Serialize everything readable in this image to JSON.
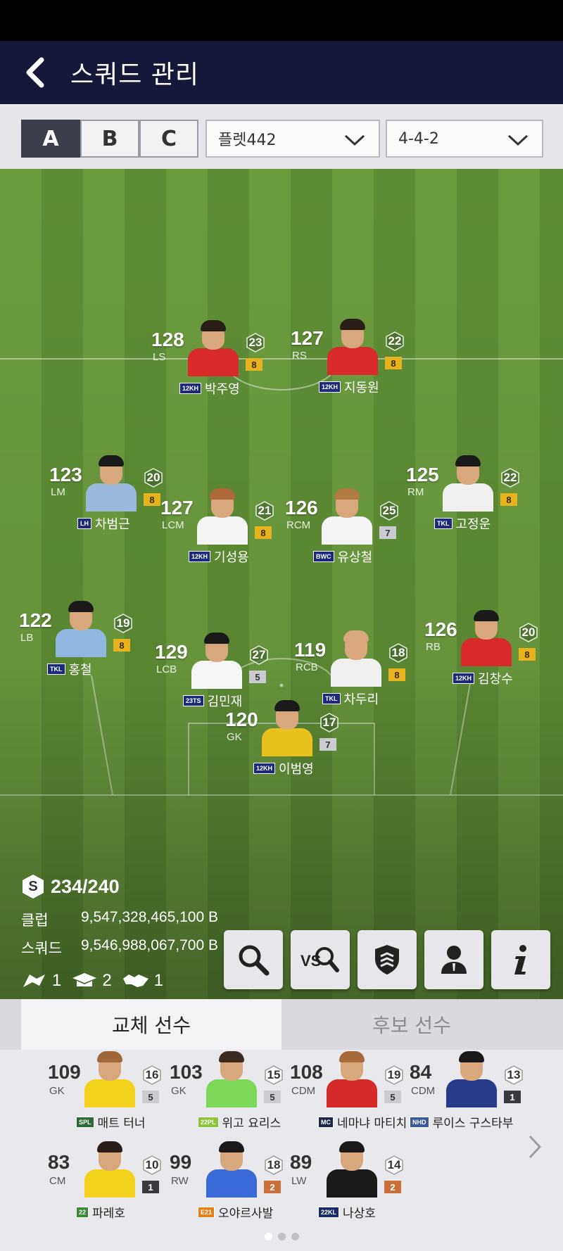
{
  "header": {
    "title": "스쿼드 관리"
  },
  "squad_tabs": [
    "A",
    "B",
    "C"
  ],
  "formation_select": "플렛442",
  "formation_value": "4-4-2",
  "colors": {
    "header_bg": "#16183a",
    "pitch_dark": "#5f8d35",
    "pitch_light": "#6c9b3e",
    "grade_gold": "#e6b31e"
  },
  "players": [
    {
      "ovr": "128",
      "pos": "LS",
      "level": "23",
      "grade": "8",
      "season": "12KH",
      "name": "박주영",
      "kit": "#d92a2a",
      "hair": "#2a1f18",
      "grade_color": "gold"
    },
    {
      "ovr": "127",
      "pos": "RS",
      "level": "22",
      "grade": "8",
      "season": "12KH",
      "name": "지동원",
      "kit": "#d92a2a",
      "hair": "#2a1f18",
      "grade_color": "gold"
    },
    {
      "ovr": "123",
      "pos": "LM",
      "level": "20",
      "grade": "8",
      "season": "LH",
      "name": "차범근",
      "kit": "#9bb8dc",
      "hair": "#1a1a1a",
      "grade_color": "gold"
    },
    {
      "ovr": "125",
      "pos": "RM",
      "level": "22",
      "grade": "8",
      "season": "TKL",
      "name": "고정운",
      "kit": "#f0f0f0",
      "hair": "#1a1a1a",
      "grade_color": "gold"
    },
    {
      "ovr": "127",
      "pos": "LCM",
      "level": "21",
      "grade": "8",
      "season": "12KH",
      "name": "기성용",
      "kit": "#f4f4f4",
      "hair": "#b06a3a",
      "grade_color": "gold"
    },
    {
      "ovr": "126",
      "pos": "RCM",
      "level": "25",
      "grade": "7",
      "season": "BWC",
      "name": "유상철",
      "kit": "#f4f4f4",
      "hair": "#b07a40",
      "grade_color": "silver"
    },
    {
      "ovr": "122",
      "pos": "LB",
      "level": "19",
      "grade": "8",
      "season": "TKL",
      "name": "홍철",
      "kit": "#8fb8e0",
      "hair": "#1a1a1a",
      "grade_color": "gold"
    },
    {
      "ovr": "129",
      "pos": "LCB",
      "level": "27",
      "grade": "5",
      "season": "23TS",
      "name": "김민재",
      "kit": "#f6f6f6",
      "hair": "#1a1a1a",
      "grade_color": "silver"
    },
    {
      "ovr": "119",
      "pos": "RCB",
      "level": "18",
      "grade": "8",
      "season": "TKL",
      "name": "차두리",
      "kit": "#f0f0f0",
      "hair": "#d9a77c",
      "grade_color": "gold"
    },
    {
      "ovr": "126",
      "pos": "RB",
      "level": "20",
      "grade": "8",
      "season": "12KH",
      "name": "김창수",
      "kit": "#d92a2a",
      "hair": "#1a1a1a",
      "grade_color": "gold"
    },
    {
      "ovr": "120",
      "pos": "GK",
      "level": "17",
      "grade": "7",
      "season": "12KH",
      "name": "이범영",
      "kit": "#e8c21c",
      "hair": "#1a1a1a",
      "grade_color": "silver"
    }
  ],
  "stats": {
    "score": "234/240",
    "club_label": "클럽",
    "club_value": "9,547,328,465,100 B",
    "squad_label": "스쿼드",
    "squad_value": "9,546,988,067,700 B",
    "count1": "1",
    "count2": "2",
    "count3": "1"
  },
  "toolbar": [
    "search-icon",
    "vs-search-icon",
    "shield-icon",
    "person-icon",
    "info-icon"
  ],
  "subtabs": {
    "active": "교체 선수",
    "inactive": "후보 선수"
  },
  "bench": [
    {
      "ovr": "109",
      "pos": "GK",
      "level": "16",
      "grade": "5",
      "season": "SPL",
      "name": "매트 터너",
      "kit": "#f2d21c",
      "hair": "#a0683a",
      "grade_color": "silver"
    },
    {
      "ovr": "103",
      "pos": "GK",
      "level": "15",
      "grade": "5",
      "season": "22PL",
      "name": "위고 요리스",
      "kit": "#7dd85a",
      "hair": "#3a2a20",
      "grade_color": "silver"
    },
    {
      "ovr": "108",
      "pos": "CDM",
      "level": "19",
      "grade": "5",
      "season": "MC",
      "name": "네마냐 마티치",
      "kit": "#d42a2a",
      "hair": "#a86a3a",
      "grade_color": "silver"
    },
    {
      "ovr": "84",
      "pos": "CDM",
      "level": "13",
      "grade": "1",
      "season": "NHD",
      "name": "루이스 구스타부",
      "kit": "#2a3a8a",
      "hair": "#1a1a1a",
      "grade_color": "dark"
    },
    {
      "ovr": "83",
      "pos": "CM",
      "level": "10",
      "grade": "1",
      "season": "22",
      "name": "파레호",
      "kit": "#f2d21c",
      "hair": "#2a1f18",
      "grade_color": "dark"
    },
    {
      "ovr": "99",
      "pos": "RW",
      "level": "18",
      "grade": "2",
      "season": "E21",
      "name": "오야르사발",
      "kit": "#3a6ad8",
      "hair": "#1a1a1a",
      "grade_color": "bronze"
    },
    {
      "ovr": "89",
      "pos": "LW",
      "level": "14",
      "grade": "2",
      "season": "22KL",
      "name": "나상호",
      "kit": "#1a1a1a",
      "hair": "#1a1a1a",
      "grade_color": "bronze"
    }
  ]
}
